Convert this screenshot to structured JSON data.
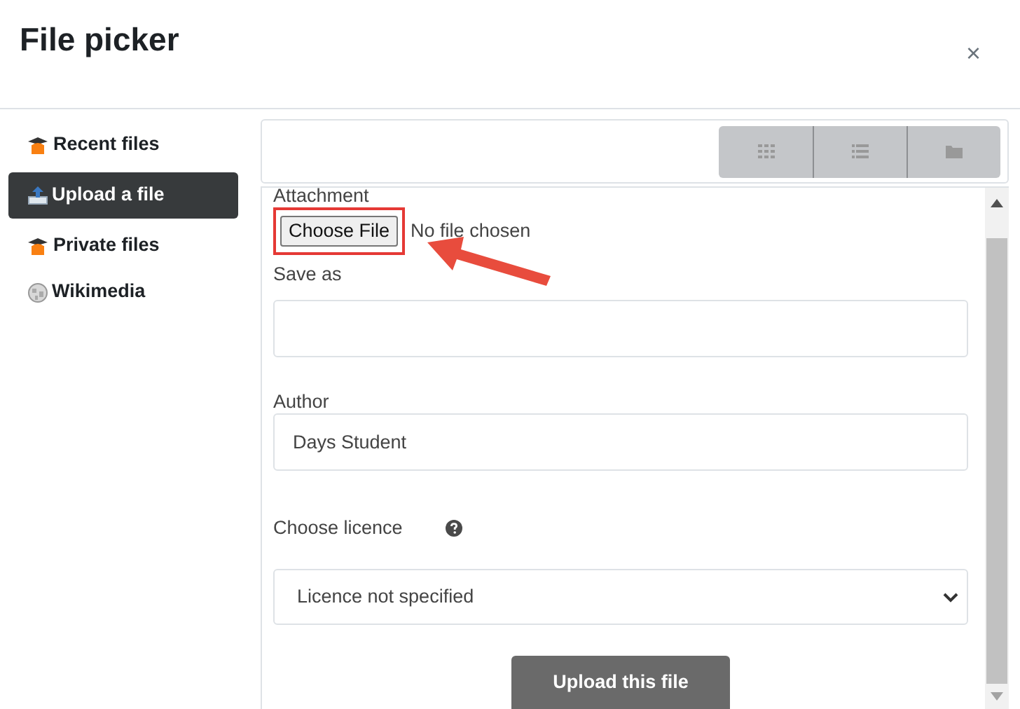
{
  "window": {
    "title": "File picker",
    "close": "×"
  },
  "sidebar": {
    "items": [
      {
        "label": "Recent files",
        "kind": "moodle",
        "selected": false
      },
      {
        "label": "Upload a file",
        "kind": "upload",
        "selected": true
      },
      {
        "label": "Private files",
        "kind": "moodle",
        "selected": false
      },
      {
        "label": "Wikimedia",
        "kind": "wiki",
        "selected": false
      }
    ]
  },
  "view_buttons": [
    {
      "kind": "grid"
    },
    {
      "kind": "list"
    },
    {
      "kind": "folder"
    }
  ],
  "form": {
    "attachment_label": "Attachment",
    "choose_button": {
      "label": "Choose File",
      "highlighted": true
    },
    "file_status": "No file chosen",
    "save_as": {
      "label": "Save as"
    },
    "author": {
      "label": "Author",
      "value": "Days Student"
    },
    "licence": {
      "label": "Choose licence",
      "value": "Licence not specified"
    },
    "submit": "Upload this file"
  }
}
